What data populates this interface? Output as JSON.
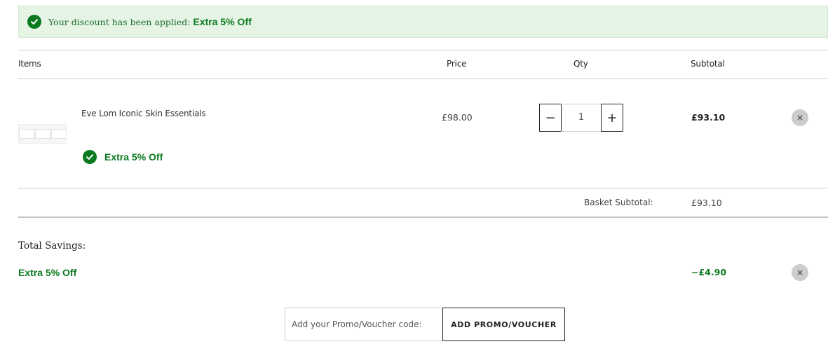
{
  "banner": {
    "message": "Your discount has been applied:",
    "offer": "Extra 5% Off",
    "icon": "check-circle-icon"
  },
  "table": {
    "headers": {
      "items": "Items",
      "price": "Price",
      "qty": "Qty",
      "subtotal": "Subtotal"
    },
    "rows": [
      {
        "name": "Eve Lom Iconic Skin Essentials",
        "offer": "Extra 5% Off",
        "price": "£98.00",
        "qty": "1",
        "subtotal": "£93.10",
        "decrease_label": "−",
        "increase_label": "+",
        "remove_label": "×"
      }
    ]
  },
  "basket": {
    "label": "Basket Subtotal:",
    "value": "£93.10"
  },
  "savings": {
    "title": "Total Savings:",
    "offer": "Extra 5% Off",
    "amount": "−£4.90",
    "remove_label": "×"
  },
  "promo": {
    "placeholder": "Add your Promo/Voucher code:",
    "button_label": "ADD PROMO/VOUCHER"
  },
  "colors": {
    "success_green": "#0b7a1f",
    "banner_bg": "#e6f4e5",
    "remove_bg": "#cccccc"
  }
}
